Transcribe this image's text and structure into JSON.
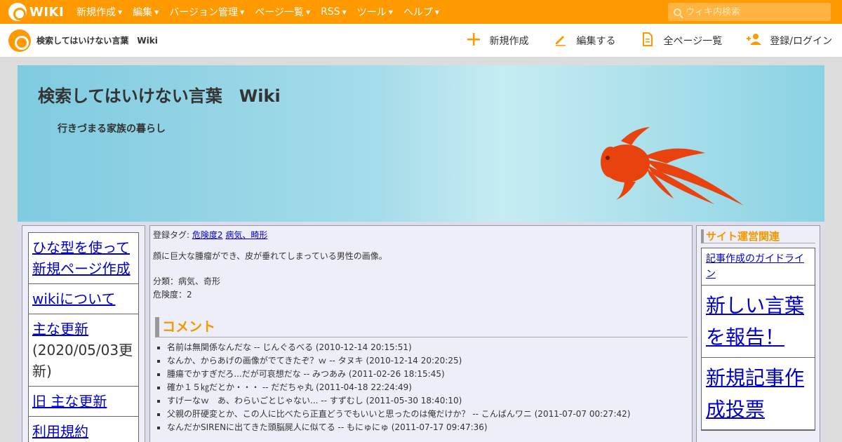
{
  "topbar": {
    "logo_text": "WIKI",
    "menu": [
      "新規作成",
      "編集",
      "バージョン管理",
      "ページ一覧",
      "RSS",
      "ツール",
      "ヘルプ"
    ],
    "search_placeholder": "ウィキ内検索"
  },
  "subbar": {
    "site_name": "検索してはいけない言葉　Wiki",
    "actions": [
      {
        "label": "新規作成",
        "icon": "plus-icon"
      },
      {
        "label": "編集する",
        "icon": "pencil-icon"
      },
      {
        "label": "全ページ一覧",
        "icon": "document-icon"
      },
      {
        "label": "登録/ログイン",
        "icon": "user-add-icon"
      }
    ]
  },
  "banner": {
    "title": "検索してはいけない言葉　Wiki",
    "tagline": "行きづまる家族の暮らし"
  },
  "left_nav": [
    {
      "label": "ひな型を使って新規ページ作成",
      "link": true
    },
    {
      "label": "wikiについて",
      "link": true
    },
    {
      "label": "主な更新",
      "link": true,
      "note": "(2020/05/03更新)"
    },
    {
      "label": "旧 主な更新",
      "link": true
    },
    {
      "label": "利用規約",
      "link": true
    }
  ],
  "main": {
    "tags_label": "登録タグ:",
    "tags": [
      "危険度2",
      "病気、畸形"
    ],
    "description": "顔に巨大な腫瘤ができ、皮が垂れてしまっている男性の画像。",
    "category": "分類：病気、奇形",
    "danger": "危険度：2",
    "comment_heading": "コメント",
    "comments": [
      "名前は無関係なんだな -- じんぐるべる (2010-12-14 20:15:51)",
      "なんか、からあげの画像がでてきたぞ？ｗ -- タヌキ (2010-12-14 20:20:25)",
      "腫瘍でかすぎだろ...だが可哀想だな -- みつあみ (2011-02-26 18:15:45)",
      "確か１５㎏だとか・・・ -- だだちゃ丸 (2011-04-18 22:24:49)",
      "すげーなｗ　あ、わらいごとじゃない... -- すずむし (2011-05-30 18:40:10)",
      "父親の肝硬変とか、この人に比べたら正直どうでもいいと思ったのは俺だけか？ -- こんばんワニ (2011-07-07 00:27:42)",
      "なんだかSIRENに出てきた頭脳屍人に似てる -- もにゅにゅ (2011-07-17 09:47:36)"
    ]
  },
  "right_nav": {
    "heading": "サイト運営関連",
    "items": [
      {
        "label": "記事作成のガイドライン",
        "size": "small"
      },
      {
        "label": "新しい言葉を報告！",
        "size": "big"
      },
      {
        "label": "新規記事作成投票",
        "size": "big"
      }
    ]
  },
  "colors": {
    "accent": "#ff9900",
    "heading": "#f39800",
    "link": "#0000cc",
    "fish": "#e8430f"
  }
}
